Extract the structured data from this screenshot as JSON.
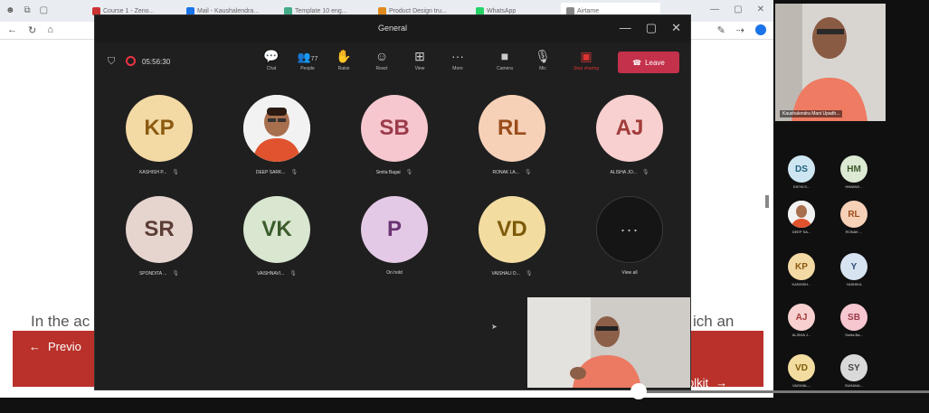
{
  "browser": {
    "tabs": [
      {
        "label": "Course 1 - Zeno..."
      },
      {
        "label": "Mail - Kaushalendra..."
      },
      {
        "label": "Template 10 eng..."
      },
      {
        "label": "Product Design tru..."
      },
      {
        "label": "WhatsApp"
      },
      {
        "label": "Airtame"
      }
    ],
    "page_text_left": "In the ac",
    "page_text_right": "ich an",
    "prev_label": "Previo",
    "next_label": "olkit"
  },
  "teams": {
    "window_title": "General",
    "timer": "05:56:30",
    "toolbar": [
      {
        "label": "Chat",
        "icon": "chat-icon"
      },
      {
        "label": "People",
        "icon": "people-icon",
        "count": "77"
      },
      {
        "label": "Raise",
        "icon": "raise-hand-icon"
      },
      {
        "label": "React",
        "icon": "react-icon"
      },
      {
        "label": "View",
        "icon": "view-icon"
      },
      {
        "label": "More",
        "icon": "more-icon"
      },
      {
        "label": "Camera",
        "icon": "camera-icon"
      },
      {
        "label": "Mic",
        "icon": "mic-icon"
      },
      {
        "label": "Stop sharing",
        "icon": "stop-share-icon"
      }
    ],
    "leave_label": "Leave",
    "participants": [
      {
        "initials": "KP",
        "name": "KASHISH P...",
        "bg": "#f3d9a4",
        "fg": "#8a5a10"
      },
      {
        "initials": "",
        "name": "DEEP SARK...",
        "bg": "#ffffff",
        "fg": "#000"
      },
      {
        "initials": "SB",
        "name": "Smita Bagai",
        "bg": "#f6c7cf",
        "fg": "#9b3b4b"
      },
      {
        "initials": "RL",
        "name": "RONAK LA...",
        "bg": "#f6d1b8",
        "fg": "#9a4d1c"
      },
      {
        "initials": "AJ",
        "name": "ALISHA JO...",
        "bg": "#f7d0cf",
        "fg": "#a13b3a"
      },
      {
        "initials": "SR",
        "name": "SPONDITA ...",
        "bg": "#e6d4cf",
        "fg": "#5b3d35"
      },
      {
        "initials": "VK",
        "name": "VAISHNAVI...",
        "bg": "#d9e6d0",
        "fg": "#3b5b2c"
      },
      {
        "initials": "P",
        "name": "On hold",
        "bg": "#e4c9e6",
        "fg": "#6a3372"
      },
      {
        "initials": "VD",
        "name": "VAISHALI D...",
        "bg": "#f3dca0",
        "fg": "#7c5a08"
      }
    ],
    "view_all_label": "View all"
  },
  "panel": {
    "speaker_name": "Kaushalendra Mani Upadh...",
    "people": [
      {
        "initials": "DS",
        "name": "DIVYA S...",
        "bg": "#cde6f2",
        "fg": "#1f5f7d"
      },
      {
        "initials": "HM",
        "name": "HIMANS...",
        "bg": "#dce9d3",
        "fg": "#3d5a2c"
      },
      {
        "initials": "",
        "name": "DEEP SA...",
        "bg": "#ffffff",
        "fg": "#000"
      },
      {
        "initials": "RL",
        "name": "RONAK ...",
        "bg": "#f6d1b8",
        "fg": "#9a4d1c"
      },
      {
        "initials": "KP",
        "name": "KASHISH...",
        "bg": "#f3d9a4",
        "fg": "#8a5a10"
      },
      {
        "initials": "Y",
        "name": "YASHIKA",
        "bg": "#d8e3f1",
        "fg": "#2e4d78"
      },
      {
        "initials": "AJ",
        "name": "ALISHA J...",
        "bg": "#f7d0cf",
        "fg": "#a13b3a"
      },
      {
        "initials": "SB",
        "name": "Smita Ba...",
        "bg": "#f6c7cf",
        "fg": "#9b3b4b"
      },
      {
        "initials": "VD",
        "name": "VAISHAL...",
        "bg": "#f3dca0",
        "fg": "#7c5a08"
      },
      {
        "initials": "SY",
        "name": "SUHANA...",
        "bg": "#d9d9d9",
        "fg": "#444"
      }
    ]
  },
  "video": {
    "progress": 0.687
  }
}
